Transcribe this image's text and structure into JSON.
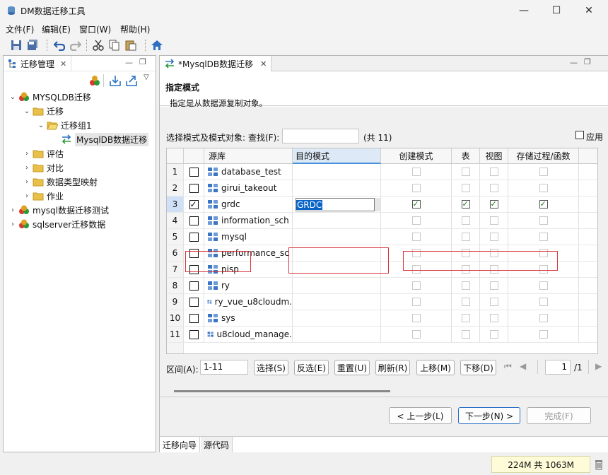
{
  "window": {
    "title": "DM数据迁移工具",
    "minimize": "—",
    "maximize": "☐",
    "close": "✕"
  },
  "menu": [
    "文件(F)",
    "编辑(E)",
    "窗口(W)",
    "帮助(H)"
  ],
  "left_panel": {
    "tab_label": "迁移管理",
    "tree": [
      {
        "label": "MYSQLDB迁移",
        "level": 0,
        "icon": "db-icon",
        "expanded": true
      },
      {
        "label": "迁移",
        "level": 1,
        "icon": "folder-icon",
        "expanded": true
      },
      {
        "label": "迁移组1",
        "level": 2,
        "icon": "folder-open-icon",
        "expanded": true
      },
      {
        "label": "MysqlDB数据迁移",
        "level": 3,
        "icon": "migrate-icon",
        "selected": true
      },
      {
        "label": "评估",
        "level": 1,
        "icon": "folder-icon",
        "expanded": false
      },
      {
        "label": "对比",
        "level": 1,
        "icon": "folder-icon",
        "expanded": false
      },
      {
        "label": "数据类型映射",
        "level": 1,
        "icon": "folder-icon",
        "expanded": false
      },
      {
        "label": "作业",
        "level": 1,
        "icon": "folder-icon",
        "expanded": false
      },
      {
        "label": "mysql数据迁移测试",
        "level": 0,
        "icon": "db-icon",
        "expanded": false
      },
      {
        "label": "sqlserver迁移数据",
        "level": 0,
        "icon": "db-icon",
        "expanded": false
      }
    ]
  },
  "editor": {
    "tab_label": "*MysqlDB数据迁移",
    "wizard_title": "指定模式",
    "wizard_desc": "指定是从数据源复制对象。",
    "select_label": "选择模式及模式对象:",
    "find_label": "查找(F):",
    "find_value": "",
    "count_label": "(共 11)",
    "apply_label": "应用",
    "columns": [
      "源库",
      "目的模式",
      "创建模式",
      "表",
      "视图",
      "存储过程/函数"
    ],
    "rows": [
      {
        "num": "1",
        "checked": false,
        "name": "database_test",
        "target": "",
        "opts": [
          false,
          false,
          false,
          false
        ]
      },
      {
        "num": "2",
        "checked": false,
        "name": "girui_takeout",
        "target": "",
        "opts": [
          false,
          false,
          false,
          false
        ]
      },
      {
        "num": "3",
        "checked": true,
        "name": "grdc",
        "target": "GRDC",
        "opts": [
          true,
          true,
          true,
          true
        ]
      },
      {
        "num": "4",
        "checked": false,
        "name": "information_sch",
        "target": "",
        "opts": [
          false,
          false,
          false,
          false
        ]
      },
      {
        "num": "5",
        "checked": false,
        "name": "mysql",
        "target": "",
        "opts": [
          false,
          false,
          false,
          false
        ]
      },
      {
        "num": "6",
        "checked": false,
        "name": "performance_sc",
        "target": "",
        "opts": [
          false,
          false,
          false,
          false
        ]
      },
      {
        "num": "7",
        "checked": false,
        "name": "pisp",
        "target": "",
        "opts": [
          false,
          false,
          false,
          false
        ]
      },
      {
        "num": "8",
        "checked": false,
        "name": "ry",
        "target": "",
        "opts": [
          false,
          false,
          false,
          false
        ]
      },
      {
        "num": "9",
        "checked": false,
        "name": "ry_vue_u8cloudm.",
        "target": "",
        "opts": [
          false,
          false,
          false,
          false
        ]
      },
      {
        "num": "10",
        "checked": false,
        "name": "sys",
        "target": "",
        "opts": [
          false,
          false,
          false,
          false
        ]
      },
      {
        "num": "11",
        "checked": false,
        "name": "u8cloud_manage.",
        "target": "",
        "opts": [
          false,
          false,
          false,
          false
        ]
      }
    ],
    "range_label": "区间(A):",
    "range_value": "1-11",
    "buttons": [
      "选择(S)",
      "反选(E)",
      "重置(U)",
      "刷新(R)",
      "上移(M)",
      "下移(D)"
    ],
    "page_value": "1",
    "page_total": "/1",
    "nav": {
      "prev": "< 上一步(L)",
      "next": "下一步(N) >",
      "finish": "完成(F)"
    },
    "bottom_tabs": [
      "迁移向导",
      "源代码"
    ]
  },
  "status": {
    "memory": "224M 共 1063M"
  },
  "colors": {
    "highlight_border": "#d9343a",
    "selection": "#0a64c8",
    "folder": "#e8c04a"
  }
}
